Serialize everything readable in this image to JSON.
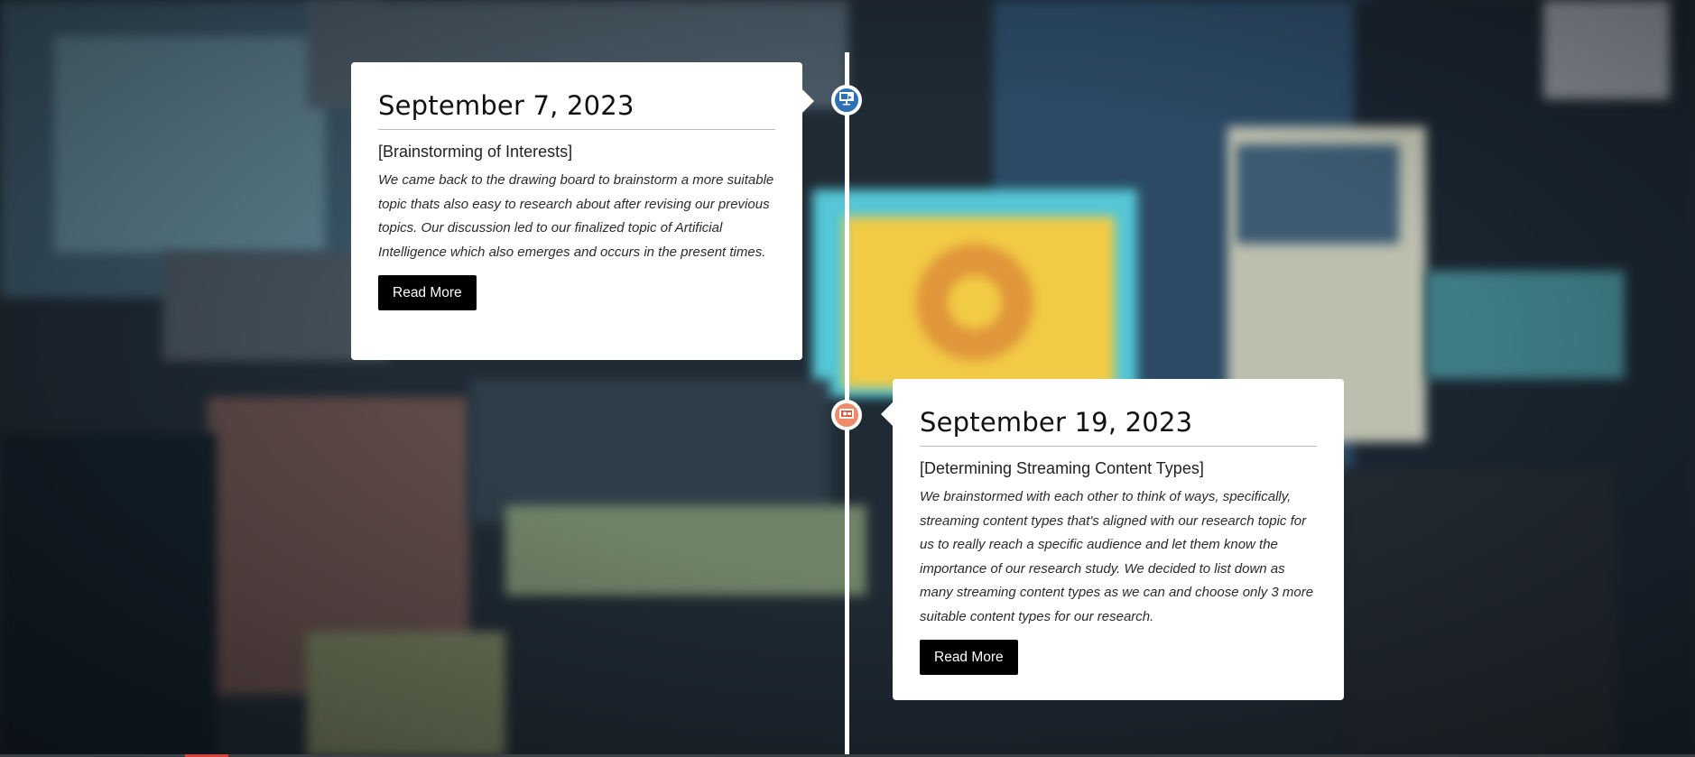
{
  "timeline": {
    "entries": [
      {
        "date": "September 7, 2023",
        "title": "[Brainstorming of Interests]",
        "description": "We came back to the drawing board to brainstorm a more suitable topic thats also easy to research about after revising our previous topics. Our discussion led to our finalized topic of Artificial Intelligence which also emerges and occurs in the present times.",
        "button_label": "Read More",
        "icon": "presentation-icon",
        "icon_color": "#2f6fb3"
      },
      {
        "date": "September 19, 2023",
        "title": "[Determining Streaming Content Types]",
        "description": "We brainstormed with each other to think of ways, specifically, streaming content types that's aligned with our research topic for us to really reach a specific audience and let them know the importance of our research study. We decided to list down as many streaming content types as we can and choose only 3 more suitable content types for our research.",
        "button_label": "Read More",
        "icon": "video-streaming-icon",
        "icon_color": "#f08b6a"
      }
    ]
  },
  "colors": {
    "card_background": "#ffffff",
    "button_background": "#000000",
    "timeline_line": "#ffffff"
  }
}
